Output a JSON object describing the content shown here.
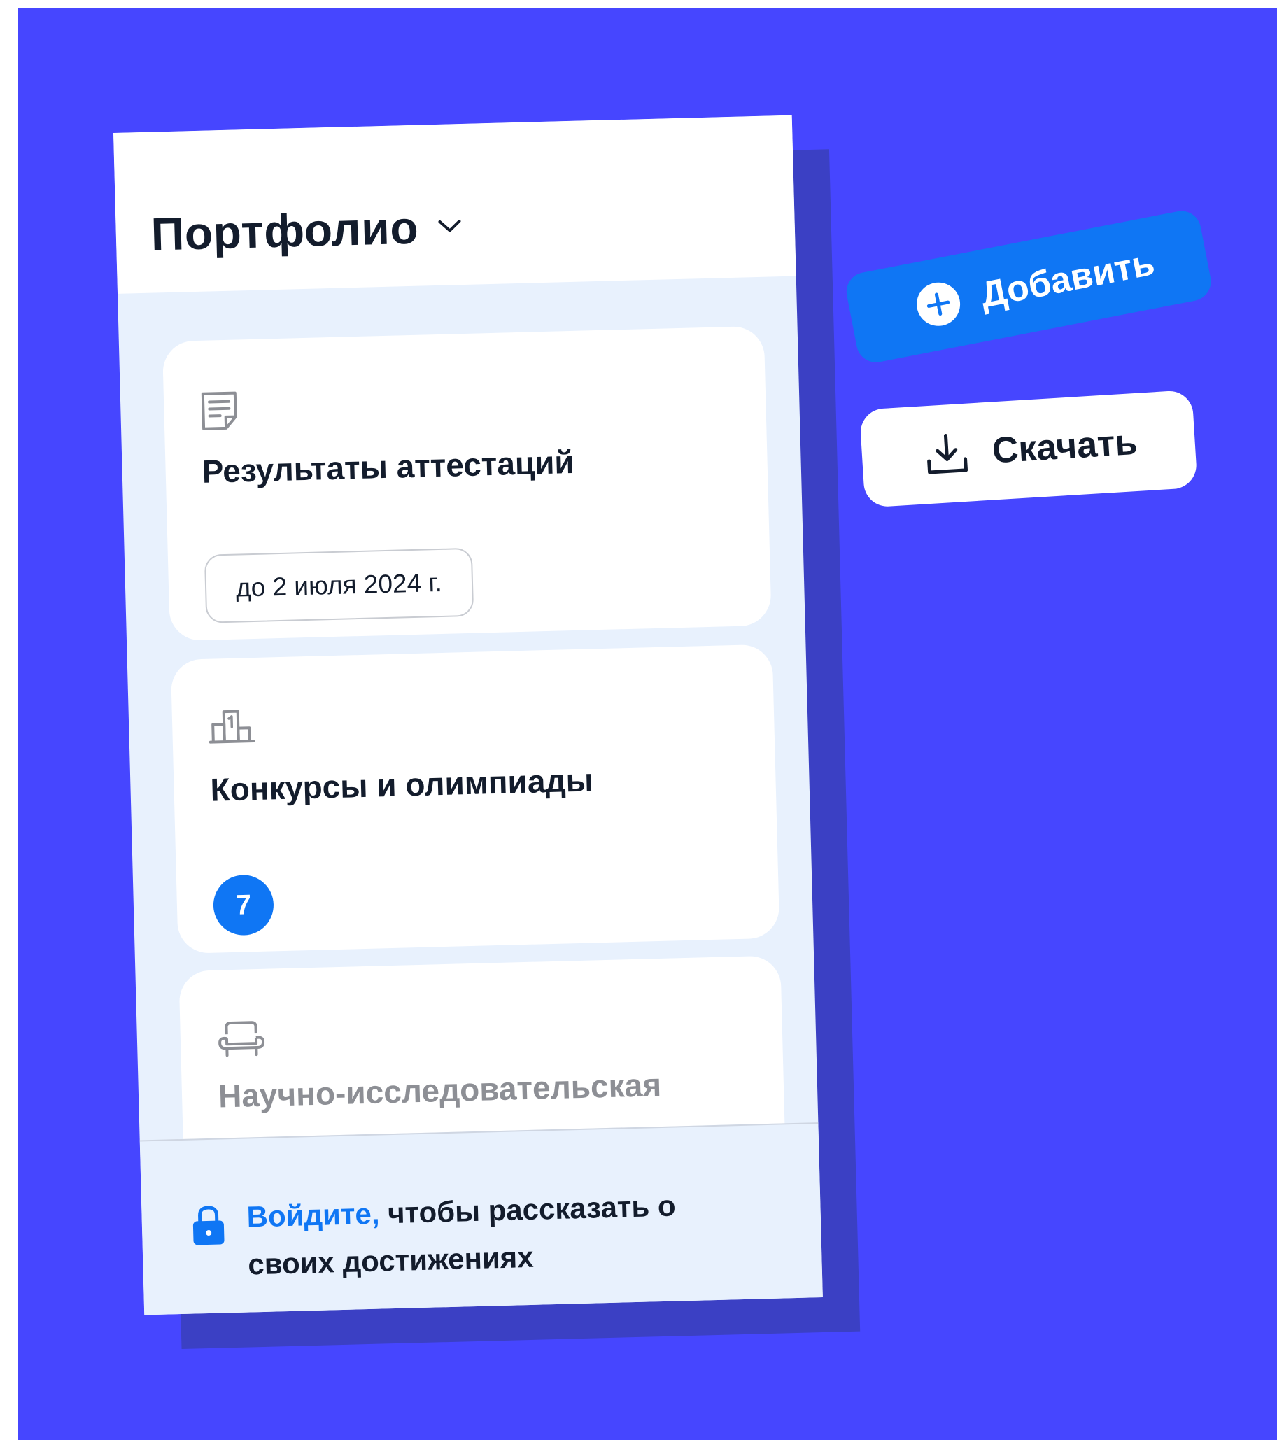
{
  "colors": {
    "background": "#4646ff",
    "phone_shadow": "#3b40c4",
    "accent": "#0f76f4",
    "text_dark": "#131c2c",
    "text_muted": "#8d8f95",
    "panel_light": "#e8f1fd"
  },
  "phone": {
    "title": "Портфолио",
    "title_icon": "chevron-down-icon",
    "cards": [
      {
        "icon": "document-icon",
        "title": "Результаты аттестаций",
        "date": "до 2 июля 2024 г."
      },
      {
        "icon": "podium-icon",
        "title": "Конкурсы и олимпиады",
        "badge": "7"
      },
      {
        "icon": "armchair-icon",
        "title": "Научно-исследовательская деятельность"
      }
    ],
    "footer": {
      "icon": "lock-icon",
      "link": "Войдите,",
      "text": "чтобы рассказать о своих достижениях"
    }
  },
  "actions": {
    "add": {
      "icon": "plus-circle-icon",
      "label": "Добавить"
    },
    "download": {
      "icon": "download-icon",
      "label": "Скачать"
    }
  }
}
